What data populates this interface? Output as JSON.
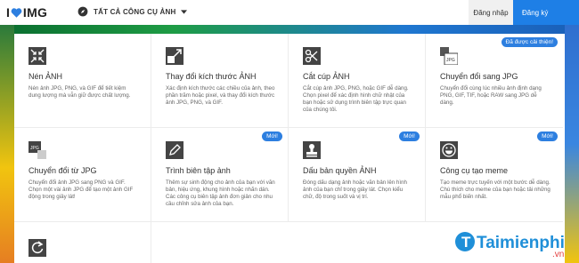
{
  "header": {
    "logo_i": "I",
    "logo_img": "IMG",
    "tools_menu": "TẤT CẢ CÔNG CỤ ẢNH",
    "login": "Đăng nhập",
    "register": "Đăng ký"
  },
  "cards": [
    {
      "title": "Nén ẢNH",
      "desc": "Nén ảnh JPG, PNG, và GIF để tiết kiệm dung lượng mà vẫn giữ được chất lượng.",
      "icon": "compress-icon",
      "badge": ""
    },
    {
      "title": "Thay đổi kích thước ẢNH",
      "desc": "Xác định kích thước các chiều của ảnh, theo phần trăm hoặc pixel, và thay đổi kích thước ảnh JPG, PNG, và GIF.",
      "icon": "resize-icon",
      "badge": ""
    },
    {
      "title": "Cắt cúp ẢNH",
      "desc": "Cắt cúp ảnh JPG, PNG, hoặc GIF dễ dàng. Chọn pixel để xác định hình chữ nhật của bạn hoặc sử dụng trình biên tập trực quan của chúng tôi.",
      "icon": "scissors-icon",
      "badge": ""
    },
    {
      "title": "Chuyển đổi sang JPG",
      "desc": "Chuyển đổi cùng lúc nhiều ảnh định dạng PNG, GIF, TIF, hoặc RAW sang JPG dễ dàng.",
      "icon": "to-jpg-icon",
      "badge": "Đã được cải thiện!"
    },
    {
      "title": "Chuyển đổi từ JPG",
      "desc": "Chuyển đổi ảnh JPG sang PNG và GIF. Chọn một vài ảnh JPG để tạo một ảnh GIF động trong giây lát!",
      "icon": "from-jpg-icon",
      "badge": ""
    },
    {
      "title": "Trình biên tập ảnh",
      "desc": "Thêm sự sinh động cho ảnh của bạn với văn bản, hiệu ứng, khung hình hoặc nhãn dán. Các công cụ biên tập ảnh đơn giản cho nhu cầu chỉnh sửa ảnh của bạn.",
      "icon": "pencil-icon",
      "badge": "Mới!"
    },
    {
      "title": "Dấu bản quyền ẢNH",
      "desc": "Đóng dấu dạng ảnh hoặc văn bản lên hình ảnh của bạn chỉ trong giây lát. Chọn kiểu chữ, độ trong suốt và vị trí.",
      "icon": "stamp-icon",
      "badge": "Mới!"
    },
    {
      "title": "Công cụ tạo meme",
      "desc": "Tạo meme trực tuyến với một bước dễ dàng. Chú thích cho meme của bạn hoặc tải những mẫu phổ biến nhất.",
      "icon": "smiley-icon",
      "badge": "Mới!"
    }
  ],
  "watermark": {
    "brand": "Taimienphi",
    "tld": ".vn"
  },
  "colors": {
    "accent": "#1e7fe6",
    "badge": "#2d7fe0",
    "heart": "#2d7fe0"
  }
}
